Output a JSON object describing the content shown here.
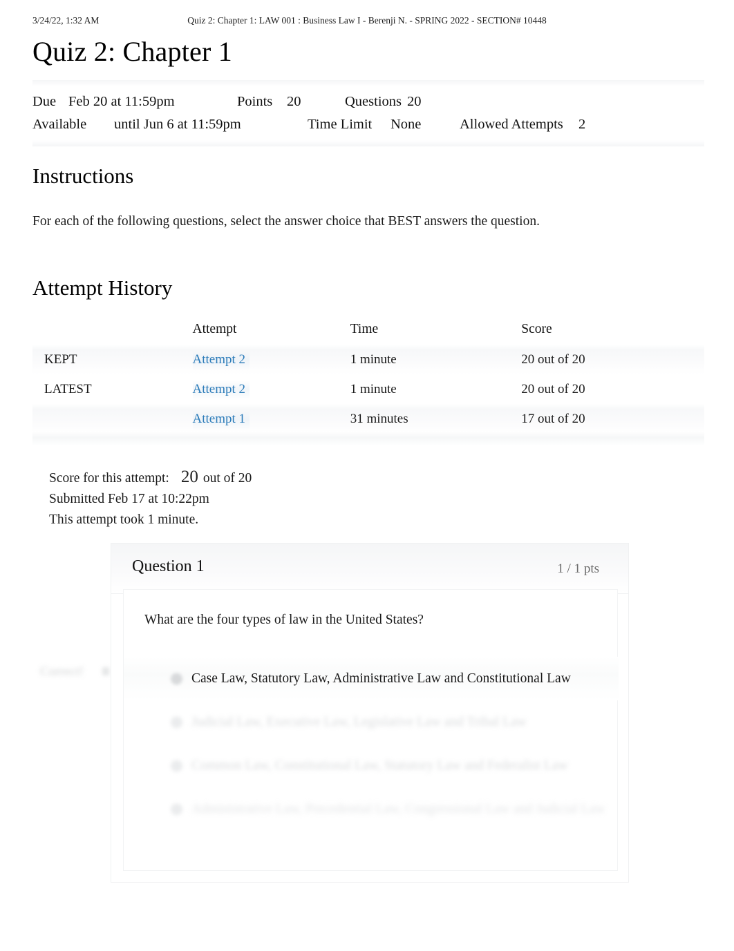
{
  "print_header": {
    "date": "3/24/22, 1:32 AM",
    "title": "Quiz 2: Chapter 1: LAW 001 : Business Law I - Berenji N. - SPRING 2022 - SECTION# 10448"
  },
  "page": {
    "title": "Quiz 2: Chapter 1"
  },
  "meta": {
    "due_label": "Due",
    "due_value": "Feb 20 at 11:59pm",
    "points_label": "Points",
    "points_value": "20",
    "questions_label": "Questions",
    "questions_value": "20",
    "available_label": "Available",
    "available_value": "until Jun 6 at 11:59pm",
    "time_limit_label": "Time Limit",
    "time_limit_value": "None",
    "allowed_attempts_label": "Allowed Attempts",
    "allowed_attempts_value": "2"
  },
  "instructions": {
    "heading": "Instructions",
    "body": "For each of the following questions, select the answer choice that BEST answers the question."
  },
  "attempt_history": {
    "heading": "Attempt History",
    "columns": [
      "",
      "Attempt",
      "Time",
      "Score"
    ],
    "rows": [
      {
        "flag": "KEPT",
        "attempt": "Attempt 2",
        "time": "1 minute",
        "score": "20 out of 20"
      },
      {
        "flag": "LATEST",
        "attempt": "Attempt 2",
        "time": "1 minute",
        "score": "20 out of 20"
      },
      {
        "flag": "",
        "attempt": "Attempt 1",
        "time": "31 minutes",
        "score": "17 out of 20"
      }
    ],
    "link_color": "#2b7bb9"
  },
  "attempt_summary": {
    "score_label": "Score for this attempt:",
    "score_value": "20",
    "score_out_of": "out of 20",
    "submitted": "Submitted Feb 17 at 10:22pm",
    "duration": "This attempt took 1 minute."
  },
  "question": {
    "name": "Question 1",
    "points": "1 / 1 pts",
    "correct_marker": "Correct!",
    "text": "What are the four types of law in the United States?",
    "answers": [
      {
        "text": "Case Law, Statutory Law, Administrative Law and Constitutional Law",
        "state": "selected"
      },
      {
        "text": "Judicial Law, Executive Law, Legislative Law and Tribal Law",
        "state": "faded"
      },
      {
        "text": "Common Law, Constitutional Law, Statutory Law and Federalist Law",
        "state": "faded"
      },
      {
        "text": "Administrative Law, Precedential Law, Congressional Law and Judicial Law",
        "state": "faded"
      }
    ]
  }
}
